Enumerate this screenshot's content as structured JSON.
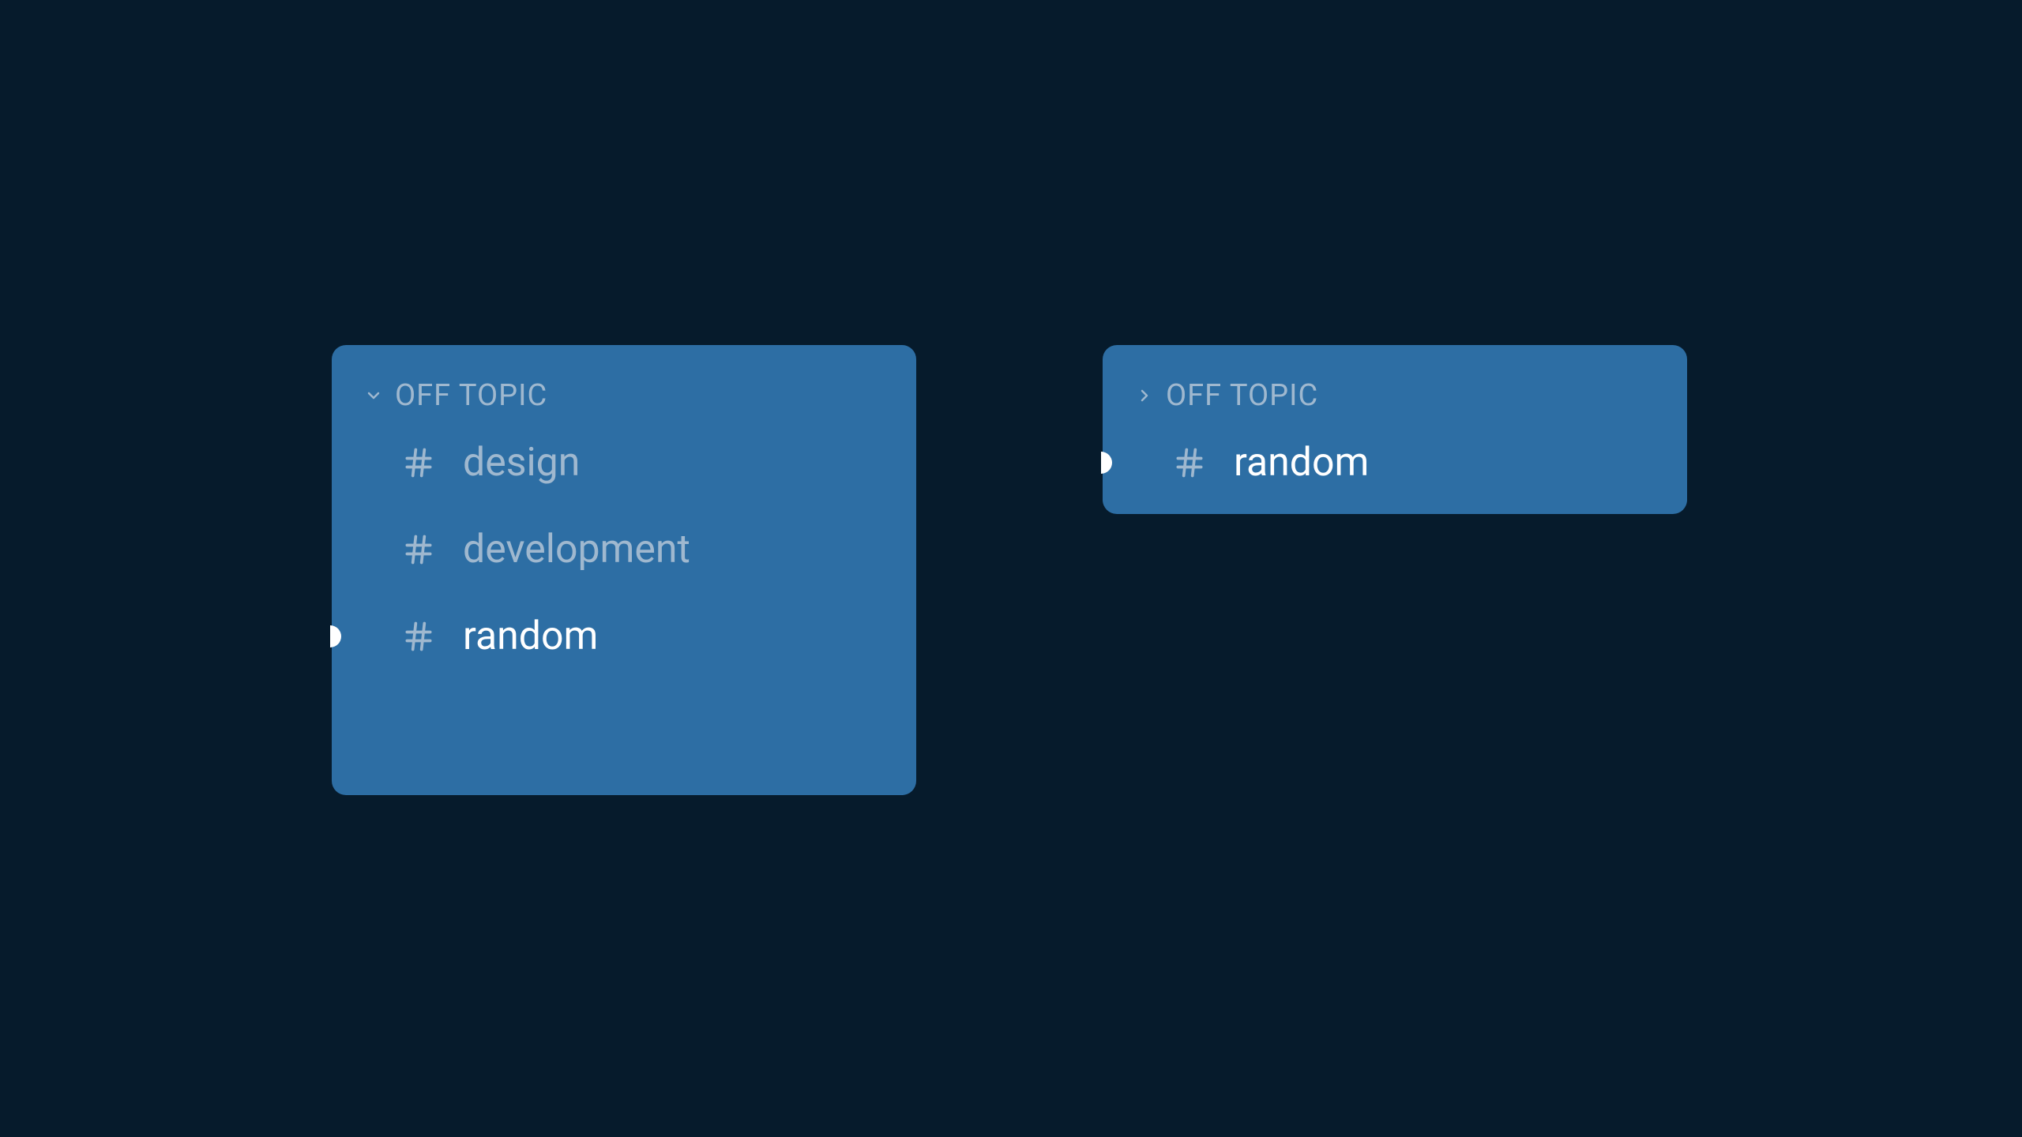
{
  "panels": {
    "left": {
      "category": "OFF TOPIC",
      "expanded": true,
      "channels": [
        {
          "name": "design",
          "active": false
        },
        {
          "name": "development",
          "active": false
        },
        {
          "name": "random",
          "active": true
        }
      ]
    },
    "right": {
      "category": "OFF TOPIC",
      "expanded": false,
      "channels": [
        {
          "name": "random",
          "active": true
        }
      ]
    }
  }
}
